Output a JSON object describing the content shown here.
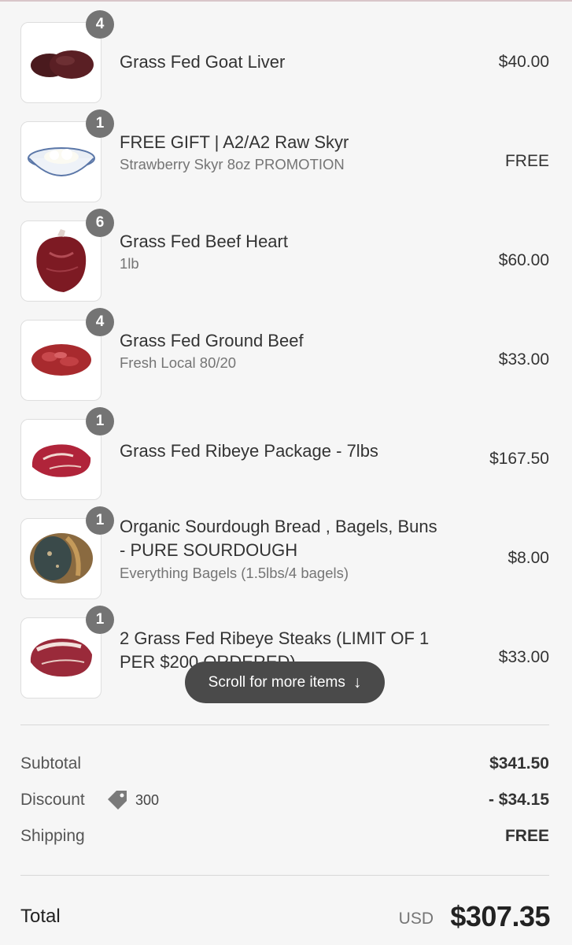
{
  "items": [
    {
      "qty": "4",
      "name": "Grass Fed Goat Liver",
      "variant": "",
      "price": "$40.00",
      "image_icon": "goat-liver-image"
    },
    {
      "qty": "1",
      "name": "FREE GIFT | A2/A2 Raw Skyr",
      "variant": "Strawberry Skyr 8oz PROMOTION",
      "price": "FREE",
      "image_icon": "skyr-bowl-image"
    },
    {
      "qty": "6",
      "name": "Grass Fed Beef Heart",
      "variant": "1lb",
      "price": "$60.00",
      "image_icon": "beef-heart-image"
    },
    {
      "qty": "4",
      "name": "Grass Fed Ground Beef",
      "variant": "Fresh Local 80/20",
      "price": "$33.00",
      "image_icon": "ground-beef-image"
    },
    {
      "qty": "1",
      "name": "Grass Fed Ribeye Package - 7lbs",
      "variant": "",
      "price": "$167.50",
      "image_icon": "ribeye-image"
    },
    {
      "qty": "1",
      "name_line1": "Organic Sourdough Bread , Bagels, Buns",
      "name_line2": "- PURE SOURDOUGH",
      "variant": "Everything Bagels (1.5lbs/4 bagels)",
      "price": "$8.00",
      "image_icon": "sourdough-bread-image"
    },
    {
      "qty": "1",
      "name_line1": "2 Grass Fed Ribeye Steaks (LIMIT OF 1",
      "name_line2": "PER $200 ORDERED)",
      "variant": "",
      "price": "$33.00",
      "image_icon": "ribeye-steaks-image"
    }
  ],
  "scroll_hint": {
    "label": "Scroll for more items",
    "icon": "arrow-down-icon"
  },
  "summary": {
    "subtotal_label": "Subtotal",
    "subtotal_value": "$341.50",
    "discount_label": "Discount",
    "discount_code": "300",
    "discount_icon": "tag-icon",
    "discount_value": "- $34.15",
    "shipping_label": "Shipping",
    "shipping_value": "FREE"
  },
  "total": {
    "label": "Total",
    "currency": "USD",
    "value": "$307.35"
  },
  "colors": {
    "background": "#f6f6f6",
    "badge": "#747474",
    "pill": "#4a4a4a",
    "text": "#333333",
    "muted": "#757575"
  }
}
